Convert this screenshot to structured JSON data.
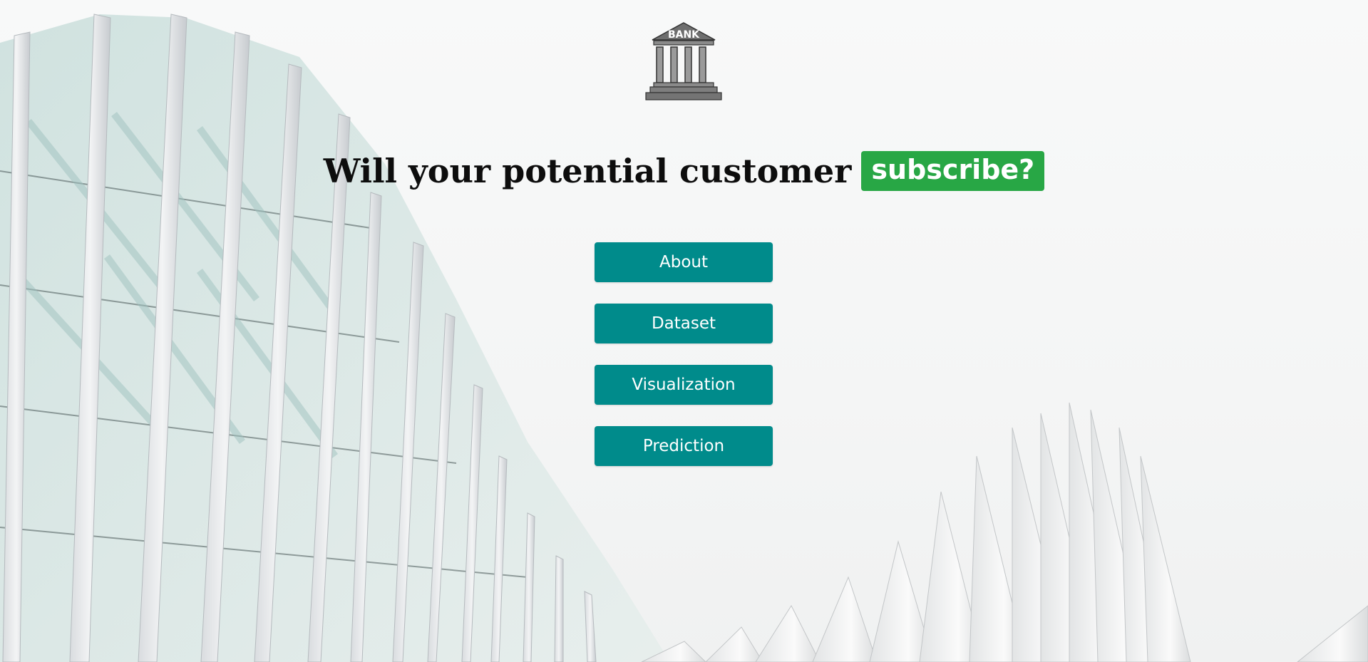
{
  "logo": {
    "text": "BANK",
    "icon": "bank-building-icon"
  },
  "headline": {
    "text": "Will your potential customer",
    "badge": "subscribe?",
    "badge_color": "#28a745"
  },
  "nav": {
    "accent_color": "#008b8b",
    "buttons": [
      {
        "label": "About"
      },
      {
        "label": "Dataset"
      },
      {
        "label": "Visualization"
      },
      {
        "label": "Prediction"
      }
    ]
  },
  "background": {
    "subject": "white-modern-architecture-icon"
  }
}
